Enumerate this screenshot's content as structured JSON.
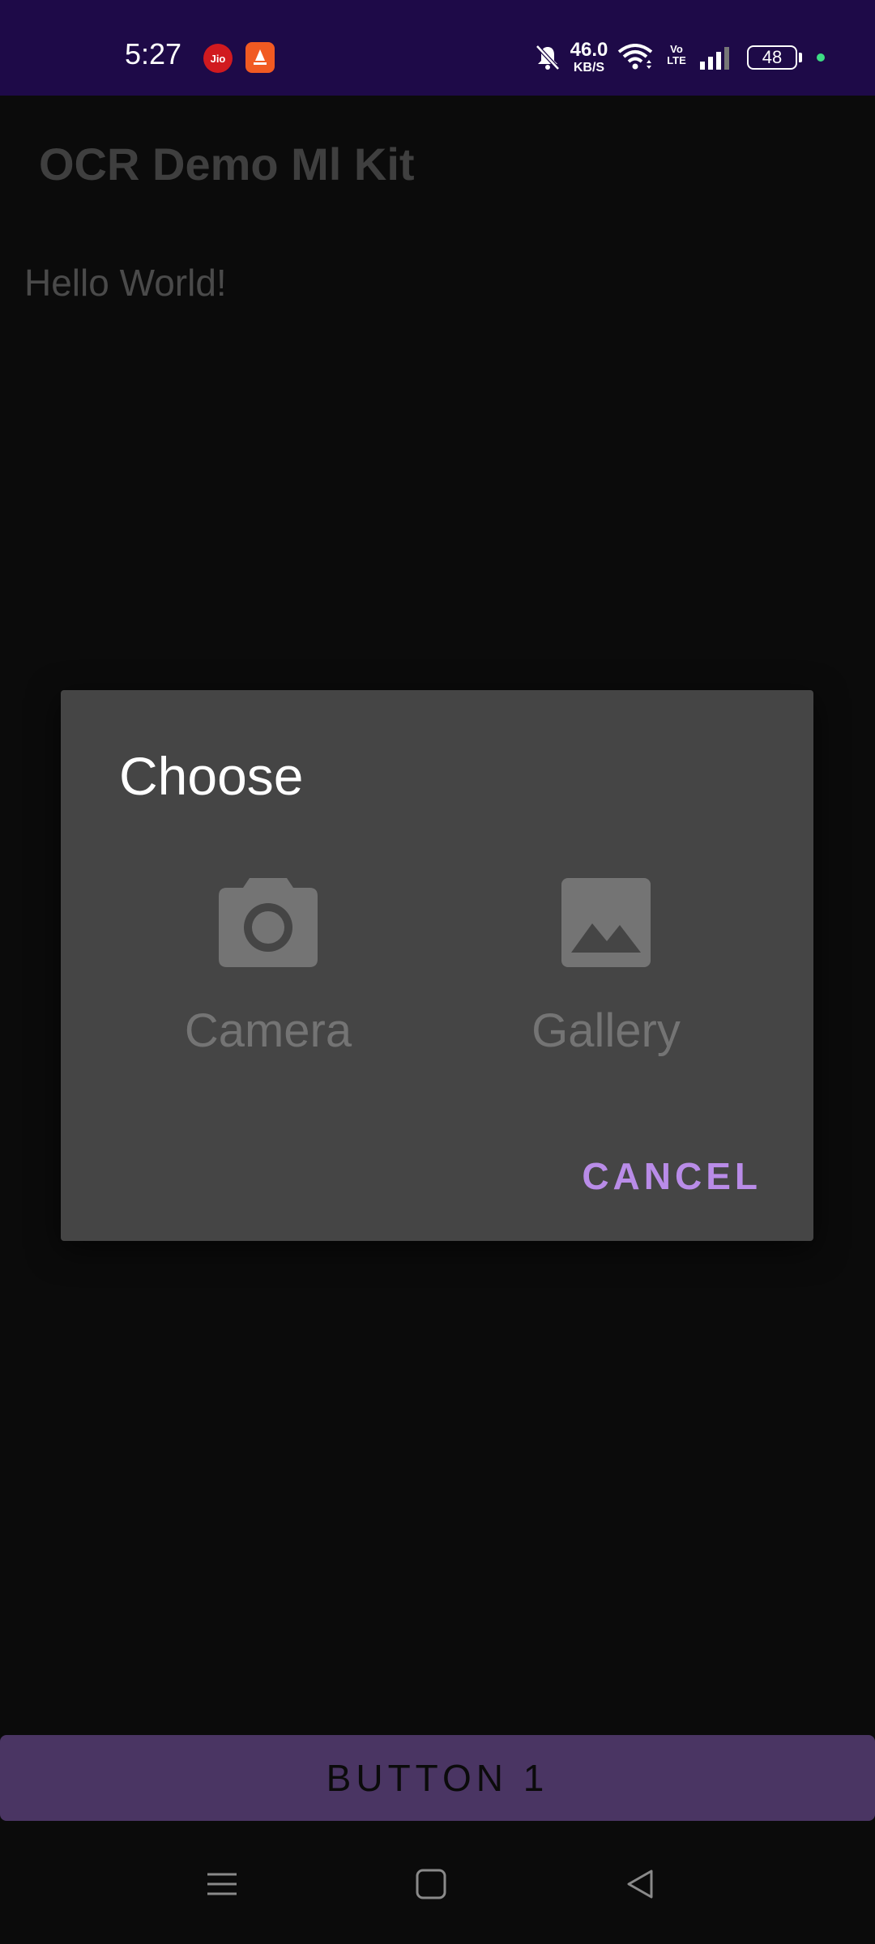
{
  "status_bar": {
    "time": "5:27",
    "jio_badge": "Jio",
    "net_speed_value": "46.0",
    "net_speed_unit": "KB/S",
    "volte_top": "Vo",
    "volte_bottom": "LTE",
    "battery_level": "48",
    "colors": {
      "background": "#1e0a48",
      "dot": "#3ddc84"
    }
  },
  "app_bar": {
    "title": "OCR Demo Ml Kit"
  },
  "content": {
    "hello_text": "Hello World!"
  },
  "dialog": {
    "title": "Choose",
    "options": [
      {
        "label": "Camera",
        "icon": "camera-icon"
      },
      {
        "label": "Gallery",
        "icon": "image-icon"
      }
    ],
    "cancel_label": "CANCEL",
    "colors": {
      "accent": "#b98ce8"
    }
  },
  "bottom_button": {
    "label": "BUTTON 1",
    "color": "#4a3563"
  },
  "nav_bar": {
    "icons": [
      "menu-icon",
      "home-square-icon",
      "back-triangle-icon"
    ]
  }
}
